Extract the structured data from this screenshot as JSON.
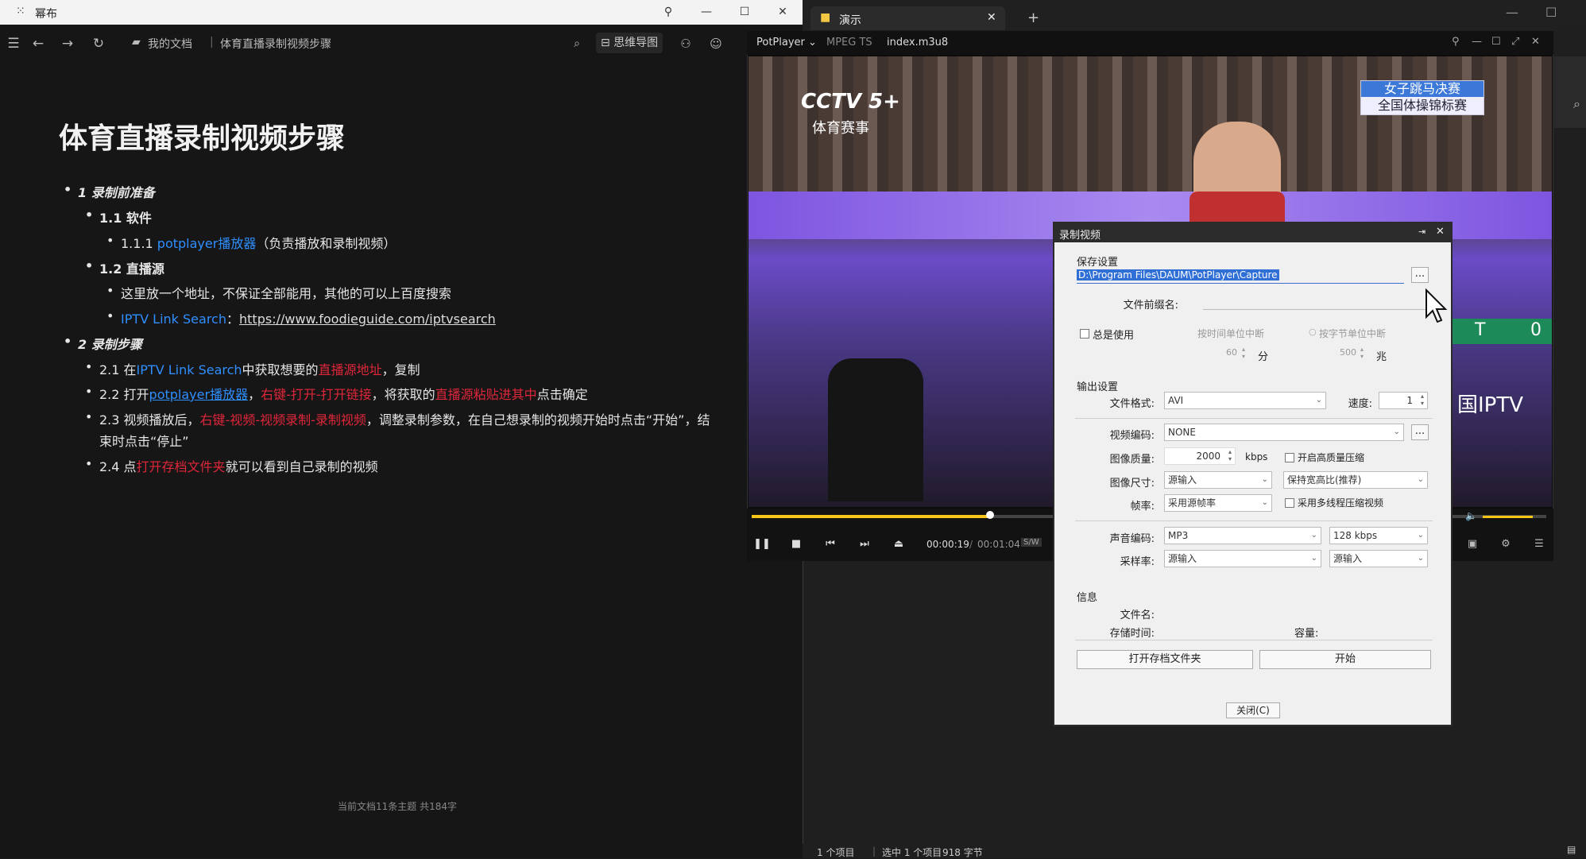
{
  "left_app": {
    "title": "幂布",
    "window_buttons": {
      "pin": "⚲",
      "min": "—",
      "max": "☐",
      "close": "✕"
    },
    "breadcrumb": {
      "root": "我的文档",
      "current": "体育直播录制视频步骤"
    },
    "toolbar": {
      "mindmap": "思维导图"
    },
    "doc": {
      "title": "体育直播录制视频步骤",
      "footer": "当前文档11条主题 共184字",
      "items": {
        "s1": "1 录制前准备",
        "s11": "1.1 软件",
        "s111_a": "1.1.1 ",
        "s111_b": "potplayer播放器",
        "s111_c": "（负责播放和录制视频）",
        "s12": "1.2 直播源",
        "s121": "这里放一个地址，不保证全部能用，其他的可以上百度搜索",
        "s122_a": "IPTV Link Search",
        "s122_b": "：",
        "s122_c": "https://www.foodieguide.com/iptvsearch",
        "s2": "2 录制步骤",
        "s21_a": "2.1 在",
        "s21_b": "IPTV Link Search",
        "s21_c": "中获取想要的",
        "s21_d": "直播源地址",
        "s21_e": "，复制",
        "s22_a": "2.2 打开",
        "s22_b": "potplayer播放器",
        "s22_c": "，",
        "s22_d": "右键-打开-打开链接",
        "s22_e": "，将获取的",
        "s22_f": "直播源粘贴进其中",
        "s22_g": "点击确定",
        "s23_a": "2.3 视频播放后，",
        "s23_b": "右键-视频-视频录制-录制视频",
        "s23_c": "，调整录制参数，在自己想录制的视频开始时点击“开始”，结",
        "s23_d": "束时点击“停止”",
        "s24_a": "2.4 点",
        "s24_b": "打开存档文件夹",
        "s24_c": "就可以看到自己录制的视频"
      }
    }
  },
  "right_app": {
    "tab": "演示",
    "tab_close": "✕",
    "new_tab": "+",
    "status": {
      "items": "1 个项目",
      "selected": "选中 1 个项目",
      "size": "918 字节"
    }
  },
  "player": {
    "app": "PotPlayer",
    "format": "MPEG TS",
    "file": "index.m3u8",
    "progress": 0.3,
    "volume": 0.9,
    "time_current": "00:00:19",
    "time_total": "00:01:04",
    "mode": "S/W",
    "video": {
      "logo": "CCTV 5+",
      "logo_sub": "体育赛事",
      "banner1": "女子跳马决赛",
      "banner2": "全国体操锦标赛",
      "iptv": "国IPTV",
      "score": "0"
    }
  },
  "record_dialog": {
    "title": "录制视频",
    "save_settings": "保存设置",
    "path": "D:\\Program Files\\DAUM\\PotPlayer\\Capture",
    "browse": "...",
    "prefix_label": "文件前缀名:",
    "always_use": "总是使用",
    "split_time": "按时间单位中断",
    "split_time_value": "60",
    "split_time_unit": "分",
    "split_bytes": "按字节单位中断",
    "split_bytes_value": "500",
    "split_bytes_unit": "兆",
    "output_settings": "输出设置",
    "format_label": "文件格式:",
    "format_value": "AVI",
    "speed_label": "速度:",
    "speed_value": "1",
    "vcodec_label": "视频编码:",
    "vcodec_value": "NONE",
    "quality_label": "图像质量:",
    "quality_value": "2000",
    "quality_unit": "kbps",
    "hq_compress": "开启高质量压缩",
    "size_label": "图像尺寸:",
    "size_value": "源输入",
    "aspect_value": "保持宽高比(推荐)",
    "fps_label": "帧率:",
    "fps_value": "采用源帧率",
    "multithread": "采用多线程压缩视频",
    "acodec_label": "声音编码:",
    "acodec_value": "MP3",
    "abitrate_value": "128 kbps",
    "samplerate_label": "采样率:",
    "samplerate_value": "源输入",
    "channels_value": "源输入",
    "info": "信息",
    "filename_label": "文件名:",
    "storetime_label": "存储时间:",
    "capacity_label": "容量:",
    "open_folder": "打开存档文件夹",
    "start": "开始",
    "close": "关闭(C)"
  }
}
